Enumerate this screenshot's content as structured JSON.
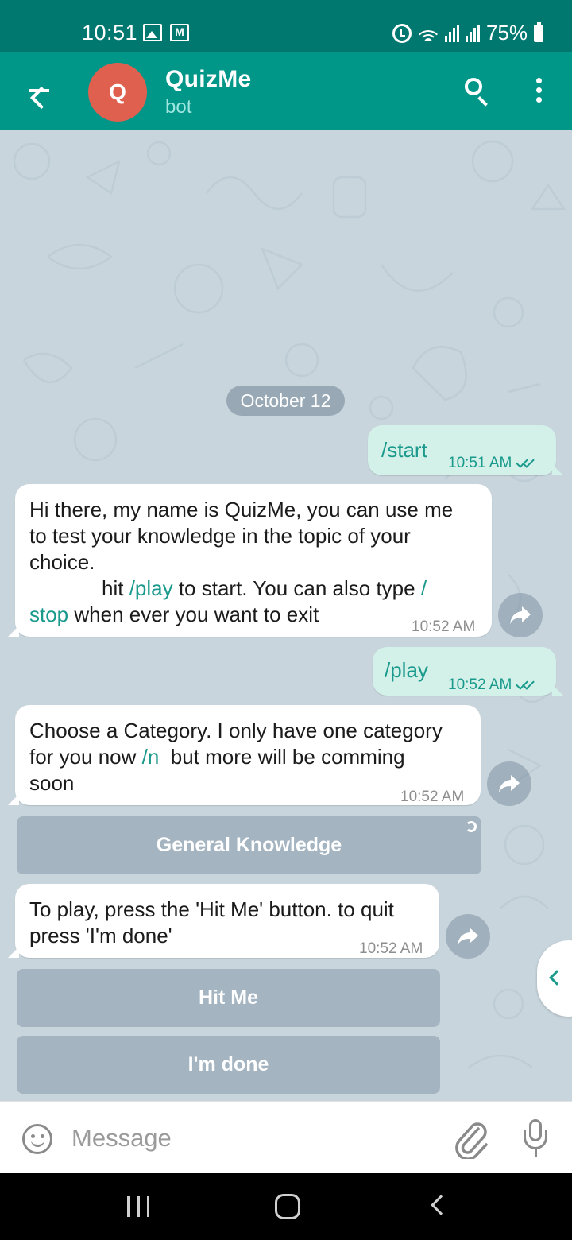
{
  "status_bar": {
    "time": "10:51",
    "battery": "75%"
  },
  "header": {
    "title": "QuizMe",
    "subtitle": "bot",
    "avatar_letter": "Q",
    "avatar_color": "#e0604f",
    "accent_color": "#009688"
  },
  "date_separator": "October 12",
  "messages": {
    "m1": {
      "text": "/start",
      "time": "10:51 AM",
      "status": "read"
    },
    "m2": {
      "line1": "Hi there, my name is QuizMe, you can use me",
      "line2": "to test your knowledge in the topic of your",
      "line3": "choice.",
      "line4_pre": "hit ",
      "line4_cmd": "/play",
      "line4_post": " to start. You can also type ",
      "line4_cmd2": "/",
      "line5_cmd": "stop",
      "line5_post": " when ever you want to exit",
      "time": "10:52 AM"
    },
    "m3": {
      "text": "/play",
      "time": "10:52 AM",
      "status": "read"
    },
    "m4": {
      "line1": "Choose a Category. I only have one category",
      "line2_pre": "for you now ",
      "line2_cmd": "/n",
      "line2_post": "  but more will be comming",
      "line3": "soon",
      "time": "10:52 AM"
    },
    "m5": {
      "line1": "To play, press the 'Hit Me' button. to quit",
      "line2": "press 'I'm done'",
      "time": "10:52 AM"
    }
  },
  "keyboard_buttons": {
    "category": "General Knowledge",
    "hit_me": "Hit Me",
    "done": "I'm done"
  },
  "composer": {
    "placeholder": "Message"
  },
  "icons": [
    "back-arrow-icon",
    "search-icon",
    "more-vert-icon",
    "share-icon",
    "emoji-icon",
    "attach-icon",
    "mic-icon"
  ]
}
